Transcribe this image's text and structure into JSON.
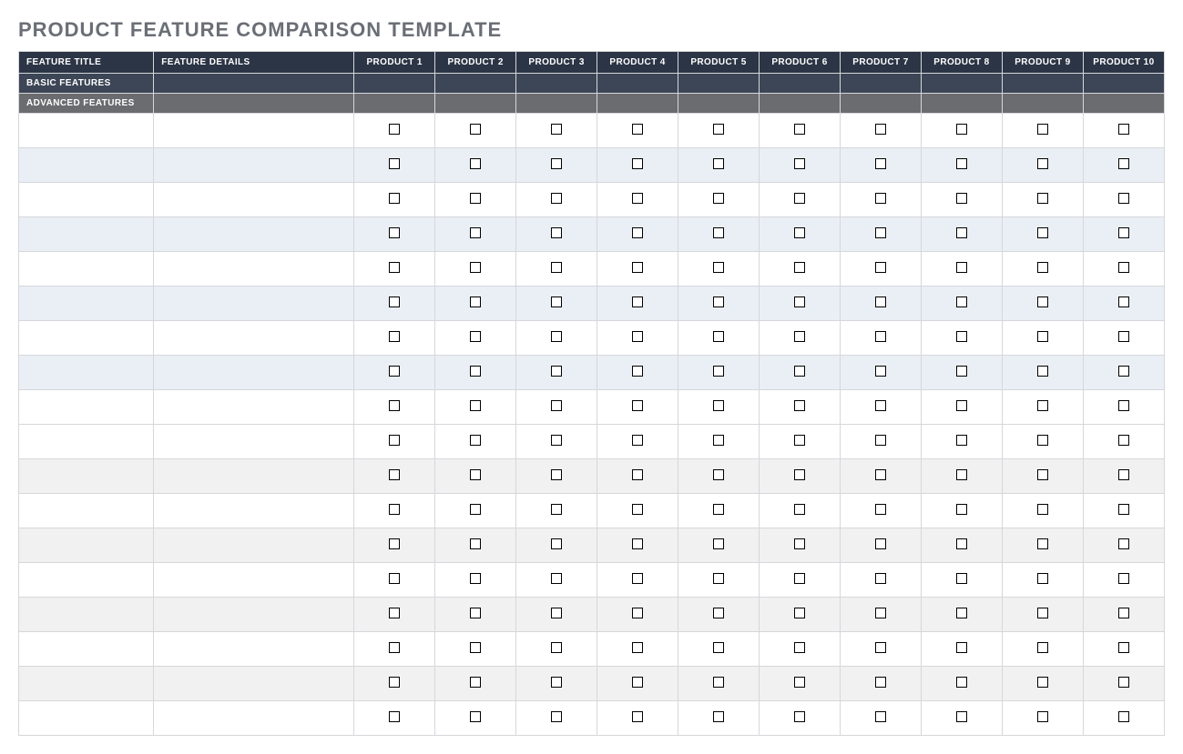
{
  "title": "PRODUCT FEATURE COMPARISON TEMPLATE",
  "headers": {
    "feature_title": "FEATURE TITLE",
    "feature_details": "FEATURE DETAILS",
    "products": [
      "PRODUCT 1",
      "PRODUCT 2",
      "PRODUCT 3",
      "PRODUCT 4",
      "PRODUCT 5",
      "PRODUCT 6",
      "PRODUCT 7",
      "PRODUCT 8",
      "PRODUCT 9",
      "PRODUCT 10"
    ]
  },
  "sections": [
    {
      "label": "BASIC FEATURES",
      "style": "basic",
      "rows": [
        {
          "title": "",
          "details": "",
          "checks": [
            false,
            false,
            false,
            false,
            false,
            false,
            false,
            false,
            false,
            false
          ]
        },
        {
          "title": "",
          "details": "",
          "checks": [
            false,
            false,
            false,
            false,
            false,
            false,
            false,
            false,
            false,
            false
          ]
        },
        {
          "title": "",
          "details": "",
          "checks": [
            false,
            false,
            false,
            false,
            false,
            false,
            false,
            false,
            false,
            false
          ]
        },
        {
          "title": "",
          "details": "",
          "checks": [
            false,
            false,
            false,
            false,
            false,
            false,
            false,
            false,
            false,
            false
          ]
        },
        {
          "title": "",
          "details": "",
          "checks": [
            false,
            false,
            false,
            false,
            false,
            false,
            false,
            false,
            false,
            false
          ]
        },
        {
          "title": "",
          "details": "",
          "checks": [
            false,
            false,
            false,
            false,
            false,
            false,
            false,
            false,
            false,
            false
          ]
        },
        {
          "title": "",
          "details": "",
          "checks": [
            false,
            false,
            false,
            false,
            false,
            false,
            false,
            false,
            false,
            false
          ]
        },
        {
          "title": "",
          "details": "",
          "checks": [
            false,
            false,
            false,
            false,
            false,
            false,
            false,
            false,
            false,
            false
          ]
        },
        {
          "title": "",
          "details": "",
          "checks": [
            false,
            false,
            false,
            false,
            false,
            false,
            false,
            false,
            false,
            false
          ]
        }
      ]
    },
    {
      "label": "ADVANCED FEATURES",
      "style": "advanced",
      "rows": [
        {
          "title": "",
          "details": "",
          "checks": [
            false,
            false,
            false,
            false,
            false,
            false,
            false,
            false,
            false,
            false
          ]
        },
        {
          "title": "",
          "details": "",
          "checks": [
            false,
            false,
            false,
            false,
            false,
            false,
            false,
            false,
            false,
            false
          ]
        },
        {
          "title": "",
          "details": "",
          "checks": [
            false,
            false,
            false,
            false,
            false,
            false,
            false,
            false,
            false,
            false
          ]
        },
        {
          "title": "",
          "details": "",
          "checks": [
            false,
            false,
            false,
            false,
            false,
            false,
            false,
            false,
            false,
            false
          ]
        },
        {
          "title": "",
          "details": "",
          "checks": [
            false,
            false,
            false,
            false,
            false,
            false,
            false,
            false,
            false,
            false
          ]
        },
        {
          "title": "",
          "details": "",
          "checks": [
            false,
            false,
            false,
            false,
            false,
            false,
            false,
            false,
            false,
            false
          ]
        },
        {
          "title": "",
          "details": "",
          "checks": [
            false,
            false,
            false,
            false,
            false,
            false,
            false,
            false,
            false,
            false
          ]
        },
        {
          "title": "",
          "details": "",
          "checks": [
            false,
            false,
            false,
            false,
            false,
            false,
            false,
            false,
            false,
            false
          ]
        },
        {
          "title": "",
          "details": "",
          "checks": [
            false,
            false,
            false,
            false,
            false,
            false,
            false,
            false,
            false,
            false
          ]
        }
      ]
    }
  ]
}
